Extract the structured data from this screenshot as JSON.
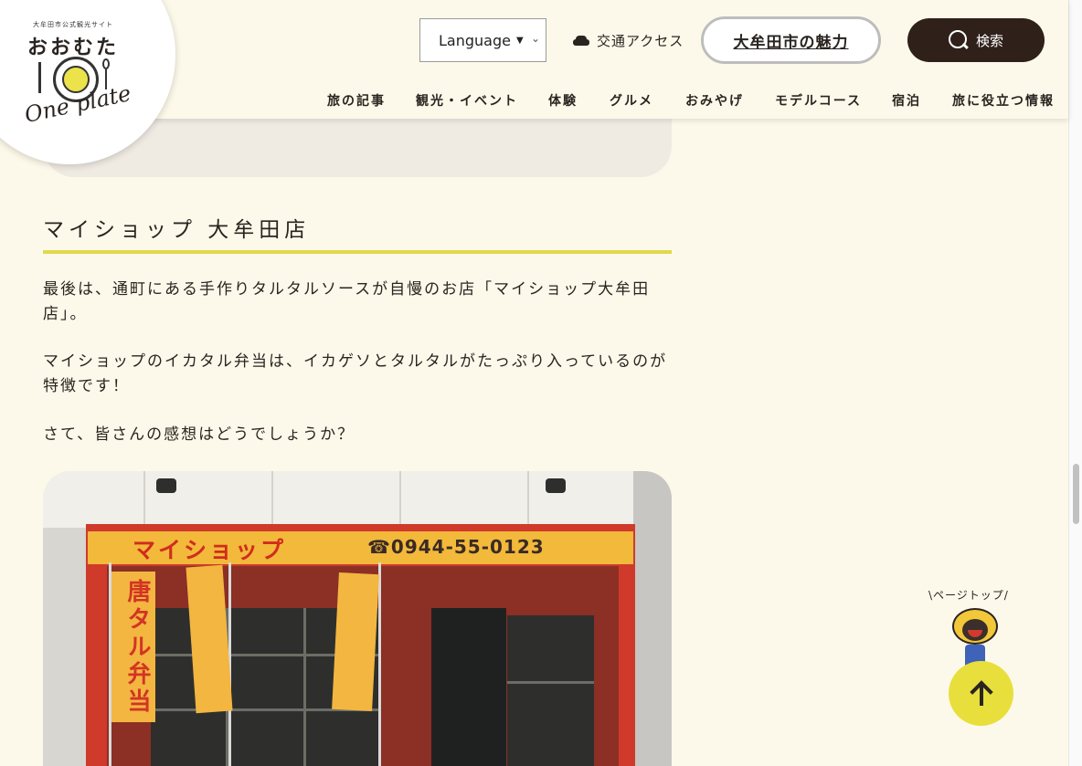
{
  "logo": {
    "subtitle": "大牟田市公式観光サイト",
    "title": "おおむた",
    "script": "One plate"
  },
  "header": {
    "language_label": "Language",
    "access_label": "交通アクセス",
    "charm_label": "大牟田市の魅力",
    "search_label": "検索"
  },
  "nav": {
    "items": [
      "旅の記事",
      "観光・イベント",
      "体験",
      "グルメ",
      "おみやげ",
      "モデルコース",
      "宿泊",
      "旅に役立つ情報"
    ]
  },
  "article": {
    "section_title": "マイショップ 大牟田店",
    "paragraphs": [
      "最後は、通町にある手作りタルタルソースが自慢のお店「マイショップ大牟田店」。",
      "マイショップのイカタル弁当は、イカゲソとタルタルがたっぷり入っているのが特徴です！",
      "さて、皆さんの感想はどうでしょうか？"
    ],
    "photo": {
      "sign_text": "マイショップ",
      "phone_text": "☎0944-55-0123",
      "flag_left": "唐タル弁当"
    }
  },
  "pagetop": {
    "label": "\\ページトップ/"
  },
  "colors": {
    "background": "#fdf9ea",
    "accent_yellow": "#e1d94a",
    "dark_brown": "#2f201a"
  }
}
